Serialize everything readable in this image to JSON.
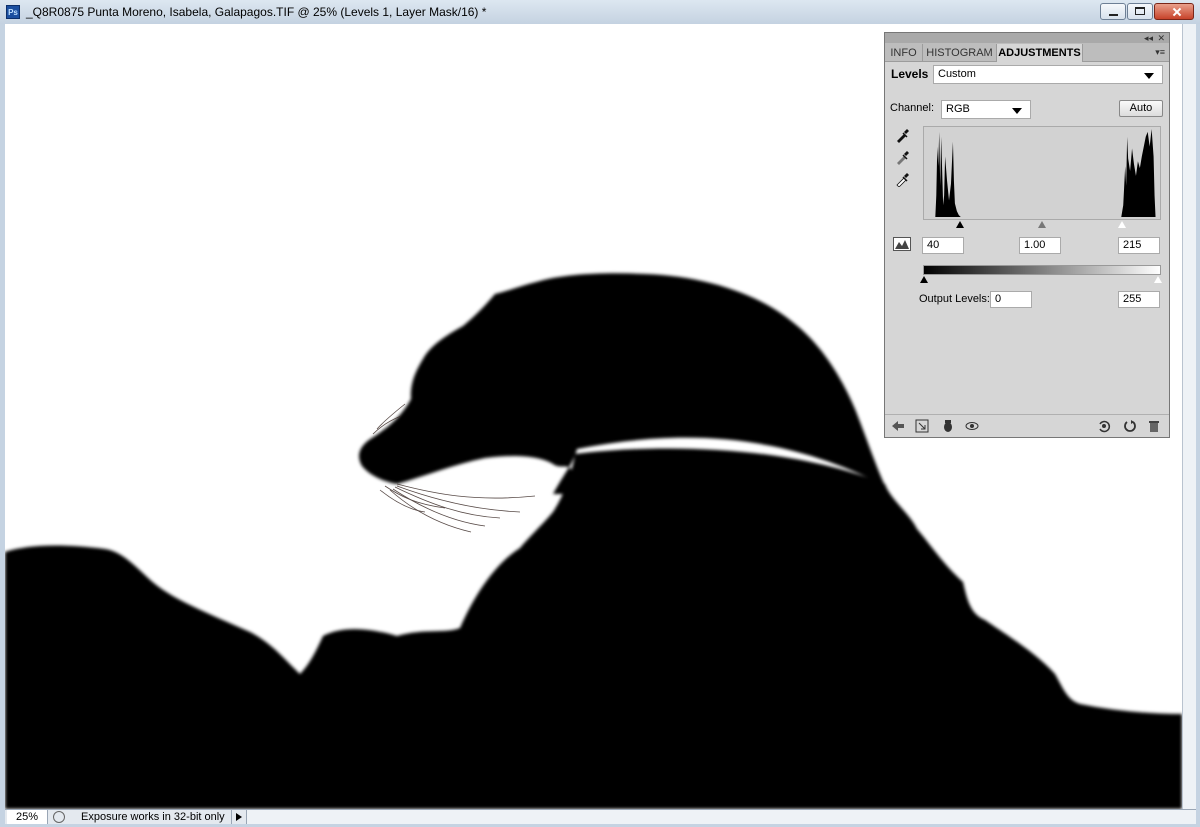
{
  "window": {
    "app_icon": "Ps",
    "title": "_Q8R0875  Punta Moreno,  Isabela, Galapagos.TIF @ 25% (Levels 1, Layer Mask/16) *",
    "controls": [
      "minimize-icon",
      "maximize-icon",
      "close-icon"
    ]
  },
  "status_bar": {
    "zoom": "25%",
    "message": "Exposure works in 32-bit only"
  },
  "adjustments_panel": {
    "tabs": [
      {
        "label": "INFO",
        "active": false
      },
      {
        "label": "HISTOGRAM",
        "active": false
      },
      {
        "label": "ADJUSTMENTS",
        "active": true
      }
    ],
    "adjustment_label": "Levels",
    "preset_value": "Custom",
    "channel_label": "Channel:",
    "channel_value": "RGB",
    "auto_label": "Auto",
    "input_levels": {
      "black": "40",
      "gamma": "1.00",
      "white": "215"
    },
    "output_label": "Output Levels:",
    "output_levels": {
      "black": "0",
      "white": "255"
    },
    "colors": {
      "panel_bg": "#d6d6d6",
      "active_tab": "#d6d6d6"
    }
  }
}
